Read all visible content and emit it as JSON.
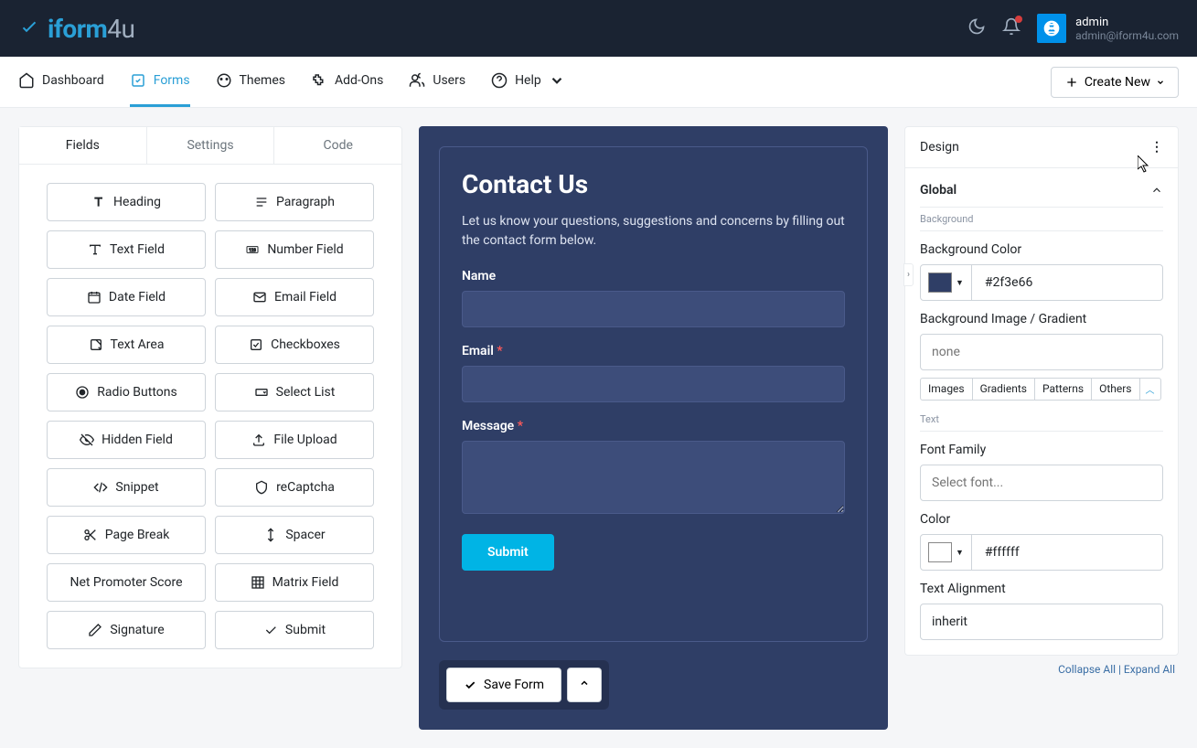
{
  "topbar": {
    "logo_brand": "iform",
    "logo_suffix": "4u"
  },
  "user": {
    "name": "admin",
    "email": "admin@iform4u.com"
  },
  "nav": {
    "dashboard": "Dashboard",
    "forms": "Forms",
    "themes": "Themes",
    "addons": "Add-Ons",
    "users": "Users",
    "help": "Help",
    "create_new": "Create New"
  },
  "left": {
    "tabs": {
      "fields": "Fields",
      "settings": "Settings",
      "code": "Code"
    },
    "fields": {
      "heading": "Heading",
      "paragraph": "Paragraph",
      "text_field": "Text Field",
      "number_field": "Number Field",
      "date_field": "Date Field",
      "email_field": "Email Field",
      "text_area": "Text Area",
      "checkboxes": "Checkboxes",
      "radio_buttons": "Radio Buttons",
      "select_list": "Select List",
      "hidden_field": "Hidden Field",
      "file_upload": "File Upload",
      "snippet": "Snippet",
      "recaptcha": "reCaptcha",
      "page_break": "Page Break",
      "spacer": "Spacer",
      "nps": "Net Promoter Score",
      "matrix": "Matrix Field",
      "signature": "Signature",
      "submit": "Submit"
    }
  },
  "form": {
    "title": "Contact Us",
    "description": "Let us know your questions, suggestions and concerns by filling out the contact form below.",
    "name_label": "Name",
    "email_label": "Email",
    "message_label": "Message",
    "submit_label": "Submit",
    "save_label": "Save Form"
  },
  "right": {
    "title": "Design",
    "global": "Global",
    "background_sub": "Background",
    "bg_color_label": "Background Color",
    "bg_color_value": "#2f3e66",
    "bg_image_label": "Background Image / Gradient",
    "bg_image_placeholder": "none",
    "tags": {
      "images": "Images",
      "gradients": "Gradients",
      "patterns": "Patterns",
      "others": "Others"
    },
    "text_sub": "Text",
    "font_family_label": "Font Family",
    "font_family_placeholder": "Select font...",
    "color_label": "Color",
    "color_value": "#ffffff",
    "align_label": "Text Alignment",
    "align_value": "inherit",
    "collapse_all": "Collapse All",
    "expand_all": "Expand All"
  }
}
